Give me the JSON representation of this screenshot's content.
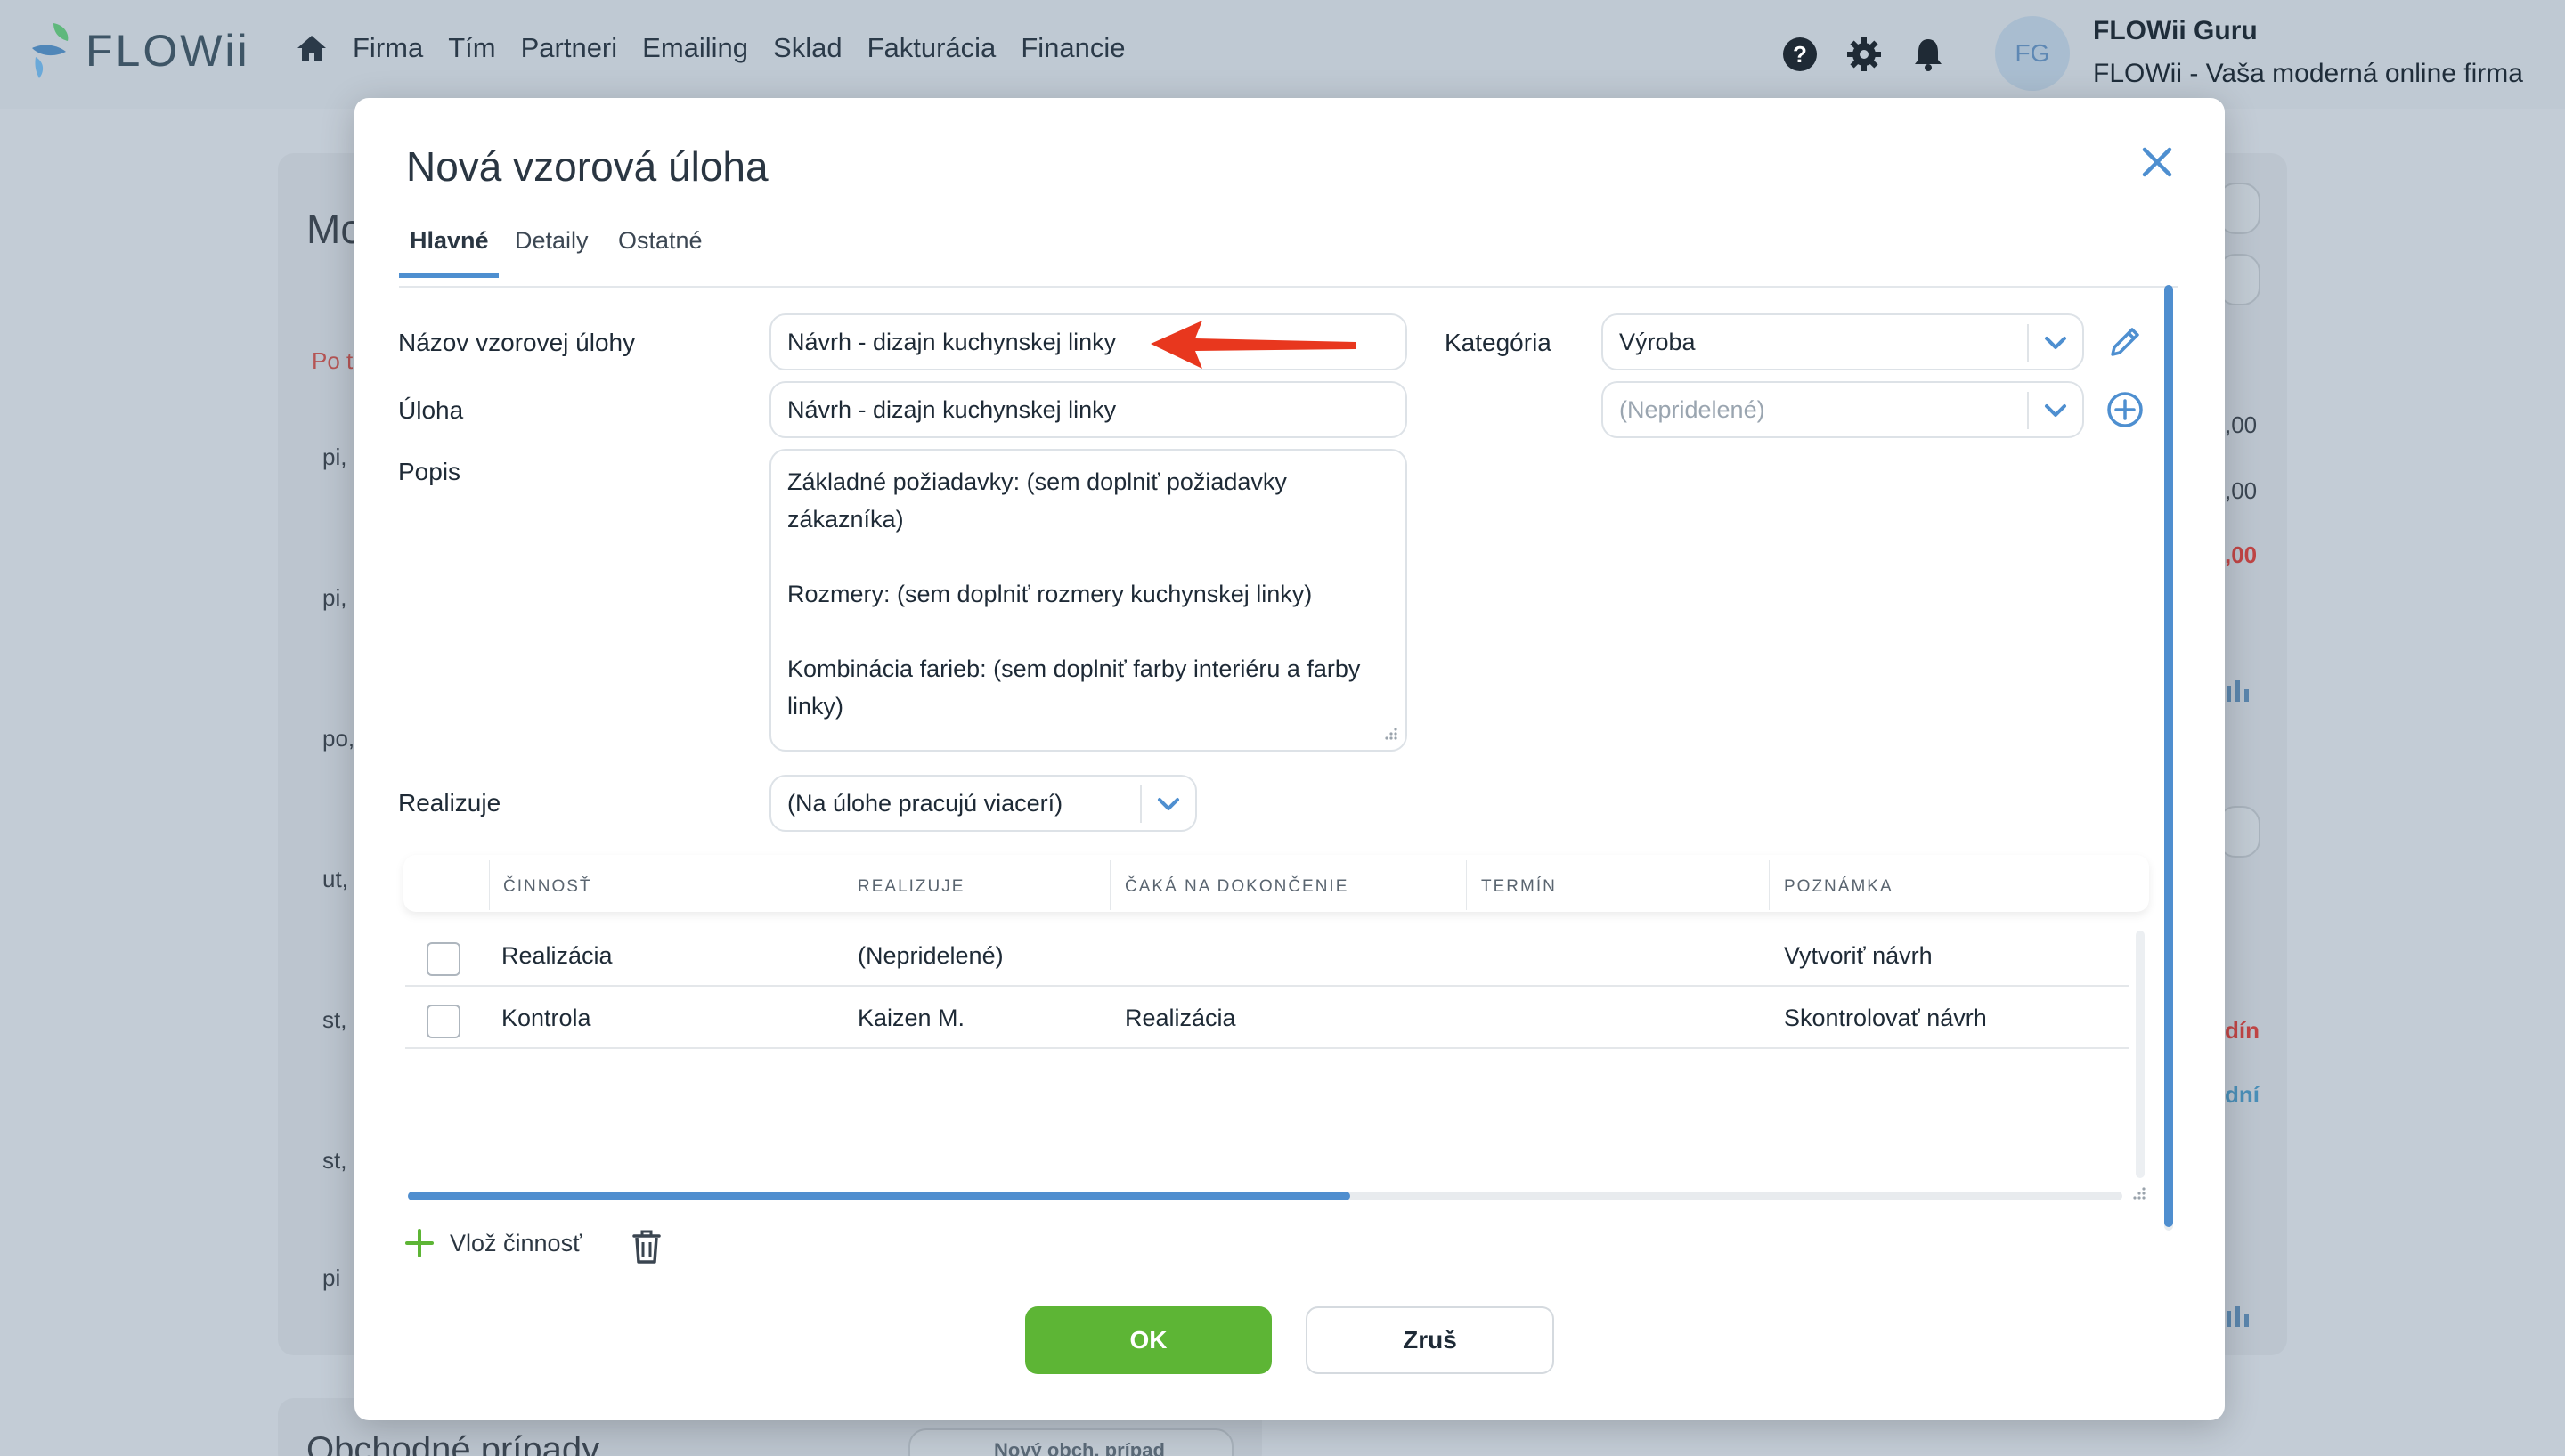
{
  "app": {
    "brand": "FLOWii",
    "nav": [
      "Firma",
      "Tím",
      "Partneri",
      "Emailing",
      "Sklad",
      "Fakturácia",
      "Financie"
    ],
    "user": {
      "initials": "FG",
      "name": "FLOWii Guru",
      "company": "FLOWii - Vaša moderná online firma"
    }
  },
  "background": {
    "card_title_partial": "Mo",
    "filter_partial": "Po t",
    "days": [
      "pi,",
      "pi,",
      "po,",
      "ut,",
      "st,",
      "st,",
      "pi"
    ],
    "amounts": [
      ",00",
      ",00",
      ",00"
    ],
    "right_labels": [
      "dín",
      "dní"
    ],
    "bottom_title": "Obchodné prípady",
    "bottom_button": "Nový obch. prípad"
  },
  "modal": {
    "title": "Nová vzorová úloha",
    "tabs": [
      "Hlavné",
      "Detaily",
      "Ostatné"
    ],
    "active_tab": "Hlavné",
    "fields": {
      "template_name": {
        "label": "Názov vzorovej úlohy",
        "value": "Návrh - dizajn kuchynskej linky"
      },
      "task": {
        "label": "Úloha",
        "value": "Návrh - dizajn kuchynskej linky"
      },
      "description": {
        "label": "Popis",
        "lines": [
          "Základné požiadavky: (sem doplniť požiadavky",
          "zákazníka)",
          "",
          "Rozmery: (sem doplniť rozmery kuchynskej linky)",
          "",
          "Kombinácia farieb: (sem doplniť farby interiéru a farby",
          "linky)"
        ]
      },
      "category": {
        "label": "Kategória",
        "value": "Výroba"
      },
      "subcategory": {
        "placeholder": "(Nepridelené)"
      },
      "assignee": {
        "label": "Realizuje",
        "value": "(Na úlohe pracujú viacerí)"
      }
    },
    "table": {
      "columns": [
        "ČINNOSŤ",
        "REALIZUJE",
        "ČAKÁ NA DOKONČENIE",
        "TERMÍN",
        "POZNÁMKA"
      ],
      "rows": [
        {
          "activity": "Realizácia",
          "assignee": "(Nepridelené)",
          "waits_for": "",
          "deadline": "",
          "note": "Vytvoriť návrh"
        },
        {
          "activity": "Kontrola",
          "assignee": "Kaizen M.",
          "waits_for": "Realizácia",
          "deadline": "",
          "note": "Skontrolovať návrh"
        }
      ]
    },
    "add_activity_label": "Vlož činnosť",
    "ok_label": "OK",
    "cancel_label": "Zruš"
  },
  "colors": {
    "accent": "#4e8fd0",
    "ok": "#5db535",
    "arrow": "#e8371e",
    "danger": "#e05050"
  }
}
